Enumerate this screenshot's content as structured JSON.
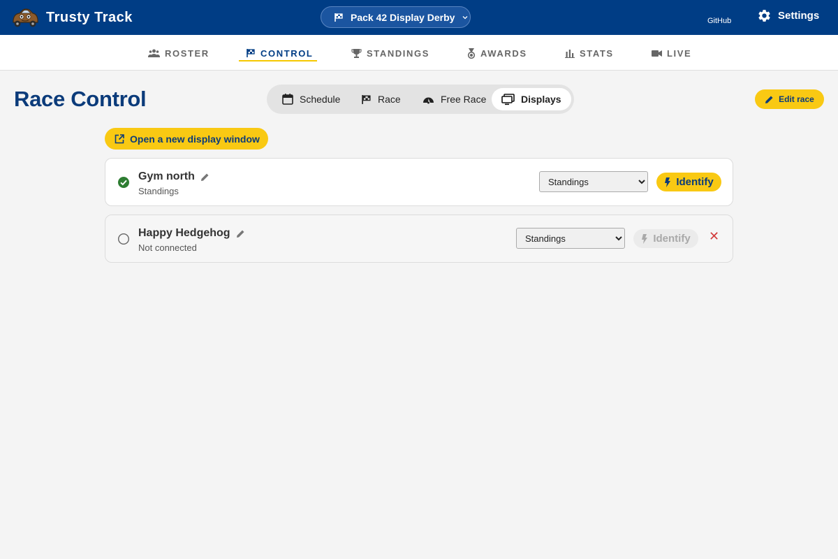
{
  "app": {
    "title": "Trusty Track"
  },
  "header": {
    "race_select_label": "Pack 42 Display Derby",
    "github_label": "GitHub",
    "settings_label": "Settings"
  },
  "nav": {
    "items": [
      {
        "label": "ROSTER",
        "icon": "people-icon"
      },
      {
        "label": "CONTROL",
        "icon": "flag-icon",
        "active": true
      },
      {
        "label": "STANDINGS",
        "icon": "trophy-icon"
      },
      {
        "label": "AWARDS",
        "icon": "medal-icon"
      },
      {
        "label": "STATS",
        "icon": "bar-chart-icon"
      },
      {
        "label": "LIVE",
        "icon": "video-camera-icon"
      }
    ]
  },
  "page": {
    "title": "Race Control",
    "edit_race_label": "Edit race",
    "open_window_label": "Open a new display window"
  },
  "segments": [
    {
      "label": "Schedule",
      "icon": "calendar-icon"
    },
    {
      "label": "Race",
      "icon": "flag-icon"
    },
    {
      "label": "Free Race",
      "icon": "speedometer-icon"
    },
    {
      "label": "Displays",
      "icon": "monitor-icon",
      "active": true
    }
  ],
  "displays": [
    {
      "name": "Gym north",
      "status": "Standings",
      "connected": true,
      "view": "Standings",
      "identify_label": "Identify"
    },
    {
      "name": "Happy Hedgehog",
      "status": "Not connected",
      "connected": false,
      "view": "Standings",
      "identify_label": "Identify",
      "remove_symbol": "✕"
    }
  ],
  "colors": {
    "header_bg": "#003d85",
    "accent": "#f9c913",
    "title_blue": "#0b3b7a",
    "connected_green": "#2e7d32",
    "remove_red": "#d23c3c"
  }
}
